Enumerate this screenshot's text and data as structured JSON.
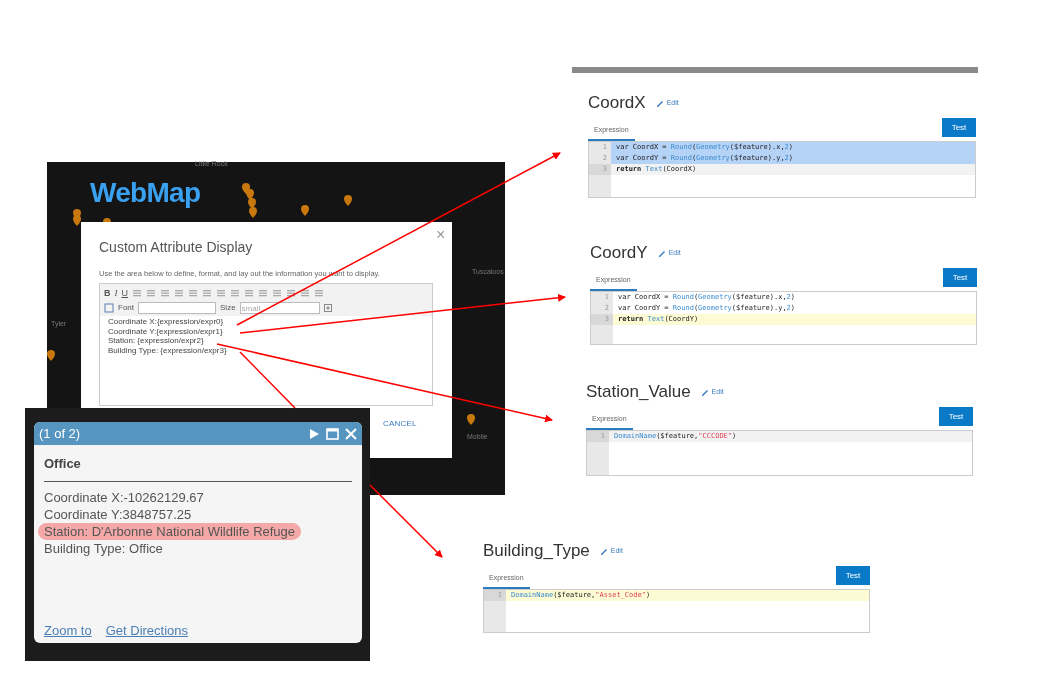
{
  "map": {
    "title": "WebMap",
    "labels": [
      {
        "text": "Little Rock",
        "kind": "top"
      },
      {
        "text": "Tyler",
        "kind": "left"
      },
      {
        "text": "Tuscaloos",
        "kind": "right"
      },
      {
        "text": "Mobile",
        "kind": "bottom"
      }
    ]
  },
  "dialog": {
    "title": "Custom Attribute Display",
    "close": "×",
    "instructions": "Use the area below to define, format, and lay out the information you want to display.",
    "format_buttons": [
      "B",
      "I",
      "U"
    ],
    "font_label": "Font",
    "size_label": "Size",
    "size_value": "small",
    "content_lines": [
      "Coordinate X:{expression/expr0}",
      "Coordinate Y:{expression/expr1}",
      "Station: {expression/expr2}",
      "Building Type: {expression/expr3}"
    ],
    "cancel": "CANCEL"
  },
  "popup": {
    "header": "(1 of 2)",
    "title": "Office",
    "lines": [
      {
        "text": "Coordinate X:-10262129.67",
        "highlighted": false
      },
      {
        "text": "Coordinate Y:3848757.25",
        "highlighted": false
      },
      {
        "text": "Station: D'Arbonne National Wildlife Refuge",
        "highlighted": true
      },
      {
        "text": "Building Type: Office",
        "highlighted": false
      }
    ],
    "links": [
      "Zoom to",
      "Get Directions"
    ]
  },
  "expressions": [
    {
      "name": "CoordX",
      "edit": "Edit",
      "tab": "Expression",
      "test": "Test",
      "focused": false,
      "lines": [
        {
          "number": "1",
          "selected": true,
          "cursor": false,
          "tokens": [
            {
              "kind": "plain",
              "text": "var CoordX  = "
            },
            {
              "kind": "func",
              "text": "Round"
            },
            {
              "kind": "plain",
              "text": "("
            },
            {
              "kind": "func2",
              "text": "Geometry"
            },
            {
              "kind": "plain",
              "text": "($feature).x,"
            },
            {
              "kind": "num",
              "text": "2"
            },
            {
              "kind": "plain",
              "text": ")"
            }
          ]
        },
        {
          "number": "2",
          "selected": true,
          "cursor": false,
          "tokens": [
            {
              "kind": "plain",
              "text": "var CoordY  = "
            },
            {
              "kind": "func",
              "text": "Round"
            },
            {
              "kind": "plain",
              "text": "("
            },
            {
              "kind": "func2",
              "text": "Geometry"
            },
            {
              "kind": "plain",
              "text": "($feature).y,"
            },
            {
              "kind": "num",
              "text": "2"
            },
            {
              "kind": "plain",
              "text": ")"
            }
          ]
        },
        {
          "number": "3",
          "selected": false,
          "cursor": true,
          "tokens": [
            {
              "kind": "keyword",
              "text": "return "
            },
            {
              "kind": "func",
              "text": "Text"
            },
            {
              "kind": "plain",
              "text": "(CoordX)"
            }
          ]
        }
      ]
    },
    {
      "name": "CoordY",
      "edit": "Edit",
      "tab": "Expression",
      "test": "Test",
      "focused": true,
      "lines": [
        {
          "number": "1",
          "selected": false,
          "cursor": false,
          "tokens": [
            {
              "kind": "plain",
              "text": "var CoordX  = "
            },
            {
              "kind": "func",
              "text": "Round"
            },
            {
              "kind": "plain",
              "text": "("
            },
            {
              "kind": "func2",
              "text": "Geometry"
            },
            {
              "kind": "plain",
              "text": "($feature).x,"
            },
            {
              "kind": "num",
              "text": "2"
            },
            {
              "kind": "plain",
              "text": ")"
            }
          ]
        },
        {
          "number": "2",
          "selected": false,
          "cursor": false,
          "tokens": [
            {
              "kind": "plain",
              "text": "var CoordY  = "
            },
            {
              "kind": "func",
              "text": "Round"
            },
            {
              "kind": "plain",
              "text": "("
            },
            {
              "kind": "func2",
              "text": "Geometry"
            },
            {
              "kind": "plain",
              "text": "($feature).y,"
            },
            {
              "kind": "num",
              "text": "2"
            },
            {
              "kind": "plain",
              "text": ")"
            }
          ]
        },
        {
          "number": "3",
          "selected": false,
          "cursor": true,
          "tokens": [
            {
              "kind": "keyword",
              "text": "return "
            },
            {
              "kind": "func",
              "text": "Text"
            },
            {
              "kind": "plain",
              "text": "(CoordY)"
            }
          ]
        }
      ]
    },
    {
      "name": "Station_Value",
      "edit": "Edit",
      "tab": "Expression",
      "test": "Test",
      "focused": false,
      "lines": [
        {
          "number": "1",
          "selected": false,
          "cursor": true,
          "tokens": [
            {
              "kind": "func",
              "text": "DomainName"
            },
            {
              "kind": "plain",
              "text": "($feature,"
            },
            {
              "kind": "string",
              "text": "\"CCCODE\""
            },
            {
              "kind": "plain",
              "text": ")"
            }
          ]
        }
      ]
    },
    {
      "name": "Building_Type",
      "edit": "Edit",
      "tab": "Expression",
      "test": "Test",
      "focused": true,
      "lines": [
        {
          "number": "1",
          "selected": false,
          "cursor": true,
          "tokens": [
            {
              "kind": "func",
              "text": "DomainName"
            },
            {
              "kind": "plain",
              "text": "($feature,"
            },
            {
              "kind": "string",
              "text": "\"Asset_Code\""
            },
            {
              "kind": "plain",
              "text": ")"
            }
          ]
        }
      ]
    }
  ]
}
